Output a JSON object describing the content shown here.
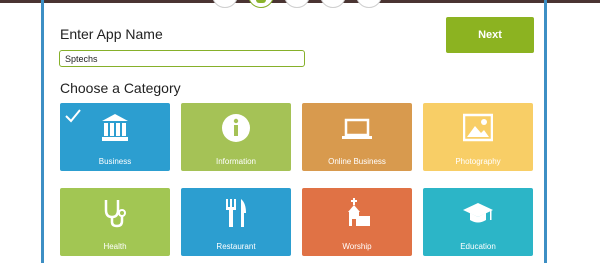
{
  "wizard": {
    "steps": [
      {
        "name": "step-1",
        "active": false
      },
      {
        "name": "step-2",
        "active": true
      },
      {
        "name": "step-3",
        "active": false
      },
      {
        "name": "step-4",
        "active": false
      },
      {
        "name": "step-5",
        "active": false
      }
    ]
  },
  "form": {
    "title": "Enter App Name",
    "app_name_value": "Sptechs",
    "next_label": "Next",
    "category_heading": "Choose a Category"
  },
  "categories": [
    {
      "label": "Business",
      "color": "#2c9ed0",
      "icon": "bank-icon",
      "selected": true
    },
    {
      "label": "Information",
      "color": "#a5c256",
      "icon": "info-icon",
      "selected": false
    },
    {
      "label": "Online Business",
      "color": "#d89a4e",
      "icon": "laptop-icon",
      "selected": false
    },
    {
      "label": "Photography",
      "color": "#f8ce66",
      "icon": "image-icon",
      "selected": false
    },
    {
      "label": "Health",
      "color": "#a2c653",
      "icon": "stethoscope-icon",
      "selected": false
    },
    {
      "label": "Restaurant",
      "color": "#2c9ed0",
      "icon": "fork-knife-icon",
      "selected": false
    },
    {
      "label": "Worship",
      "color": "#e07245",
      "icon": "church-icon",
      "selected": false
    },
    {
      "label": "Education",
      "color": "#2cb5c7",
      "icon": "graduation-cap-icon",
      "selected": false
    }
  ]
}
